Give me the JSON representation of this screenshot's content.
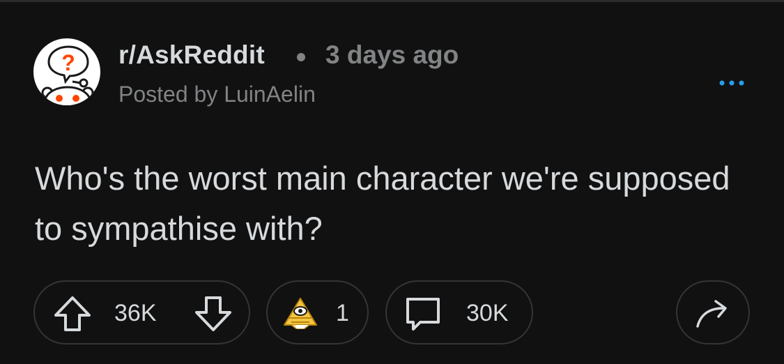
{
  "post": {
    "subreddit": "r/AskReddit",
    "separator_icon": "dot-separator-icon",
    "time_ago": "3 days ago",
    "posted_by": "Posted by LuinAelin",
    "title": "Who's the worst main character we're supposed to sympathise with?"
  },
  "actions": {
    "upvote_icon": "upvote-arrow-icon",
    "vote_count": "36K",
    "downvote_icon": "downvote-arrow-icon",
    "award_icon": "pyramid-eye-award-icon",
    "award_count": "1",
    "comment_icon": "speech-bubble-icon",
    "comment_count": "30K",
    "share_icon": "share-arrow-icon",
    "more_icon": "more-options-icon"
  },
  "colors": {
    "background": "#111112",
    "text_primary": "#d7dadc",
    "text_secondary": "#818384",
    "pill_border": "#343536",
    "accent_blue": "#24a0ed",
    "avatar_orange": "#ff4500"
  }
}
